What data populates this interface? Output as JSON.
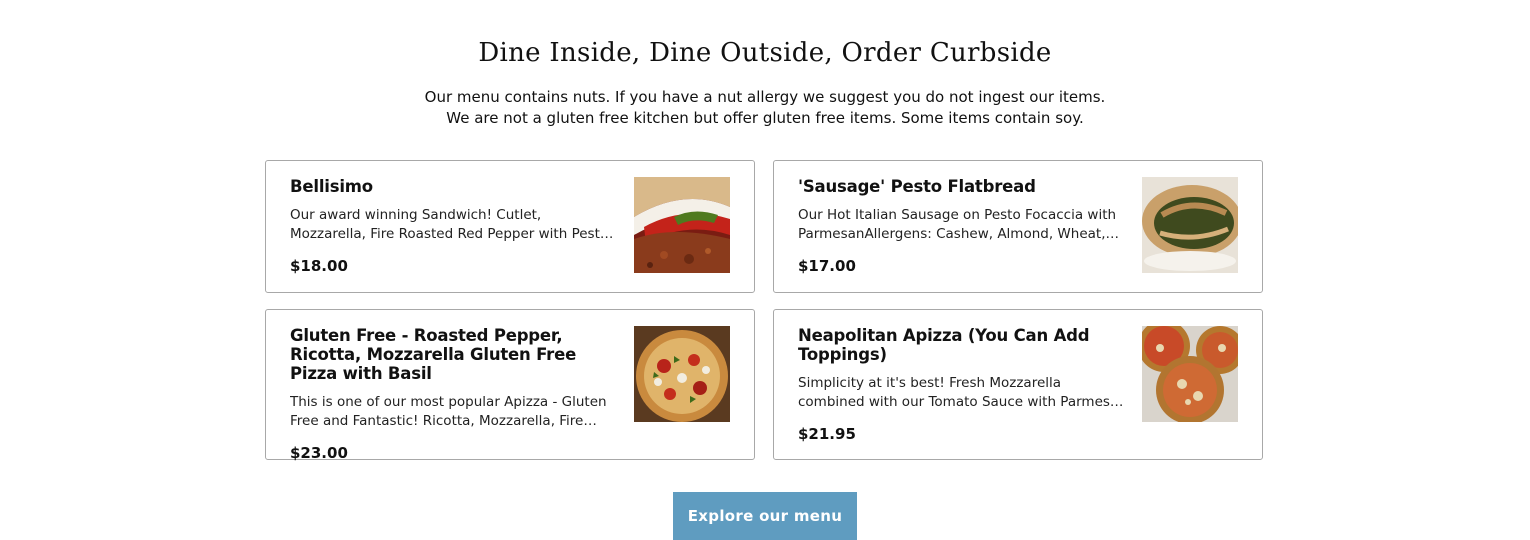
{
  "section": {
    "heading": "Dine Inside, Dine Outside, Order Curbside",
    "intro_line1": "Our menu contains nuts. If you have a nut allergy we suggest you do not ingest our items.",
    "intro_line2": "We are not a gluten free kitchen but offer gluten free items. Some items contain soy."
  },
  "menu_items": [
    {
      "name": "Bellisimo",
      "description": "Our award winning Sandwich! Cutlet, Mozzarella, Fire Roasted Red Pepper with Pesto on Fried Focaccia",
      "price": "$18.00",
      "image_icon": "sandwich-photo"
    },
    {
      "name": "'Sausage' Pesto Flatbread",
      "description": "Our Hot Italian Sausage on Pesto Focaccia with ParmesanAllergens: Cashew, Almond, Wheat, Soy",
      "price": "$17.00",
      "image_icon": "flatbread-photo"
    },
    {
      "name": "Gluten Free - Roasted Pepper, Ricotta, Mozzarella Gluten Free Pizza with Basil",
      "description": "This is one of our most popular Apizza - Gluten Free and Fantastic! Ricotta, Mozzarella, Fire Roasted Red Pepper with Basil",
      "price": "$23.00",
      "image_icon": "pizza-photo"
    },
    {
      "name": "Neapolitan Apizza (You Can Add Toppings)",
      "description": "Simplicity at it's best! Fresh Mozzarella combined with our Tomato Sauce with Parmesan and Fresh Basil",
      "price": "$21.95",
      "image_icon": "apizza-photo"
    }
  ],
  "cta": {
    "label": "Explore our menu"
  },
  "colors": {
    "button_bg": "#5f9cc0",
    "border": "#a8a8a8",
    "text": "#111111"
  }
}
